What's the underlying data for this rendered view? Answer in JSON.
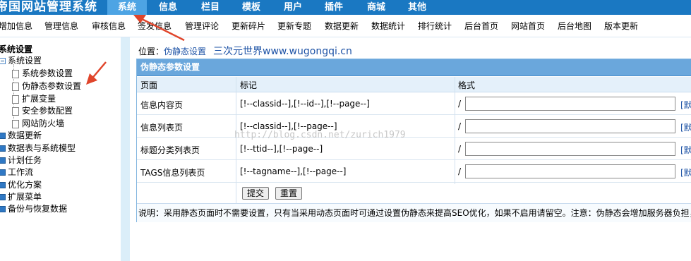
{
  "logo": {
    "text": "帝国网站管理系统"
  },
  "nav": {
    "items": [
      {
        "label": "系统",
        "active": true
      },
      {
        "label": "信息"
      },
      {
        "label": "栏目"
      },
      {
        "label": "模板"
      },
      {
        "label": "用户"
      },
      {
        "label": "插件"
      },
      {
        "label": "商城"
      },
      {
        "label": "其他"
      }
    ]
  },
  "subnav": {
    "items": [
      "增加信息",
      "管理信息",
      "审核信息",
      "签发信息",
      "管理评论",
      "更新碎片",
      "更新专题",
      "数据更新",
      "数据统计",
      "排行统计",
      "后台首页",
      "网站首页",
      "后台地图",
      "版本更新"
    ]
  },
  "sidebar": {
    "title": "系统设置",
    "tree": [
      {
        "label": "系统设置",
        "type": "expanded"
      },
      {
        "label": "系统参数设置",
        "type": "page"
      },
      {
        "label": "伪静态参数设置",
        "type": "page"
      },
      {
        "label": "扩展变量",
        "type": "page"
      },
      {
        "label": "安全参数配置",
        "type": "page"
      },
      {
        "label": "网站防火墙",
        "type": "page"
      },
      {
        "label": "数据更新",
        "type": "folder"
      },
      {
        "label": "数据表与系统模型",
        "type": "folder"
      },
      {
        "label": "计划任务",
        "type": "folder"
      },
      {
        "label": "工作流",
        "type": "folder"
      },
      {
        "label": "优化方案",
        "type": "folder"
      },
      {
        "label": "扩展菜单",
        "type": "folder"
      },
      {
        "label": "备份与恢复数据",
        "type": "folder"
      }
    ]
  },
  "location": {
    "prefix": "位置：",
    "link": "伪静态设置",
    "site": "三次元世界www.wugongqi.cn"
  },
  "panel": {
    "title": "伪静态参数设置",
    "headers": [
      "页面",
      "标记",
      "格式"
    ],
    "rows": [
      {
        "page": "信息内容页",
        "mark": "[!--classid--],[!--id--],[!--page--]",
        "prefix": "/",
        "value": "",
        "link": "[默"
      },
      {
        "page": "信息列表页",
        "mark": "[!--classid--],[!--page--]",
        "prefix": "/",
        "value": "",
        "link": "[默"
      },
      {
        "page": "标题分类列表页",
        "mark": "[!--ttid--],[!--page--]",
        "prefix": "/",
        "value": "",
        "link": "[默"
      },
      {
        "page": "TAGS信息列表页",
        "mark": "[!--tagname--],[!--page--]",
        "prefix": "/",
        "value": "",
        "link": "[默"
      }
    ],
    "submit_label": "提交",
    "reset_label": "重置",
    "note": "说明：采用静态页面时不需要设置，只有当采用动态页面时可通过设置伪静态来提高SEO优化，如果不启用请留空。注意：伪静态会增加服务器负担，"
  },
  "watermark": "http://blog.csdn.net/zurich1979",
  "colors": {
    "topbar": "#1a78c2",
    "active_tab": "#4da4e4",
    "panel_head": "#6aa7dc",
    "arrow": "#e0452b"
  }
}
